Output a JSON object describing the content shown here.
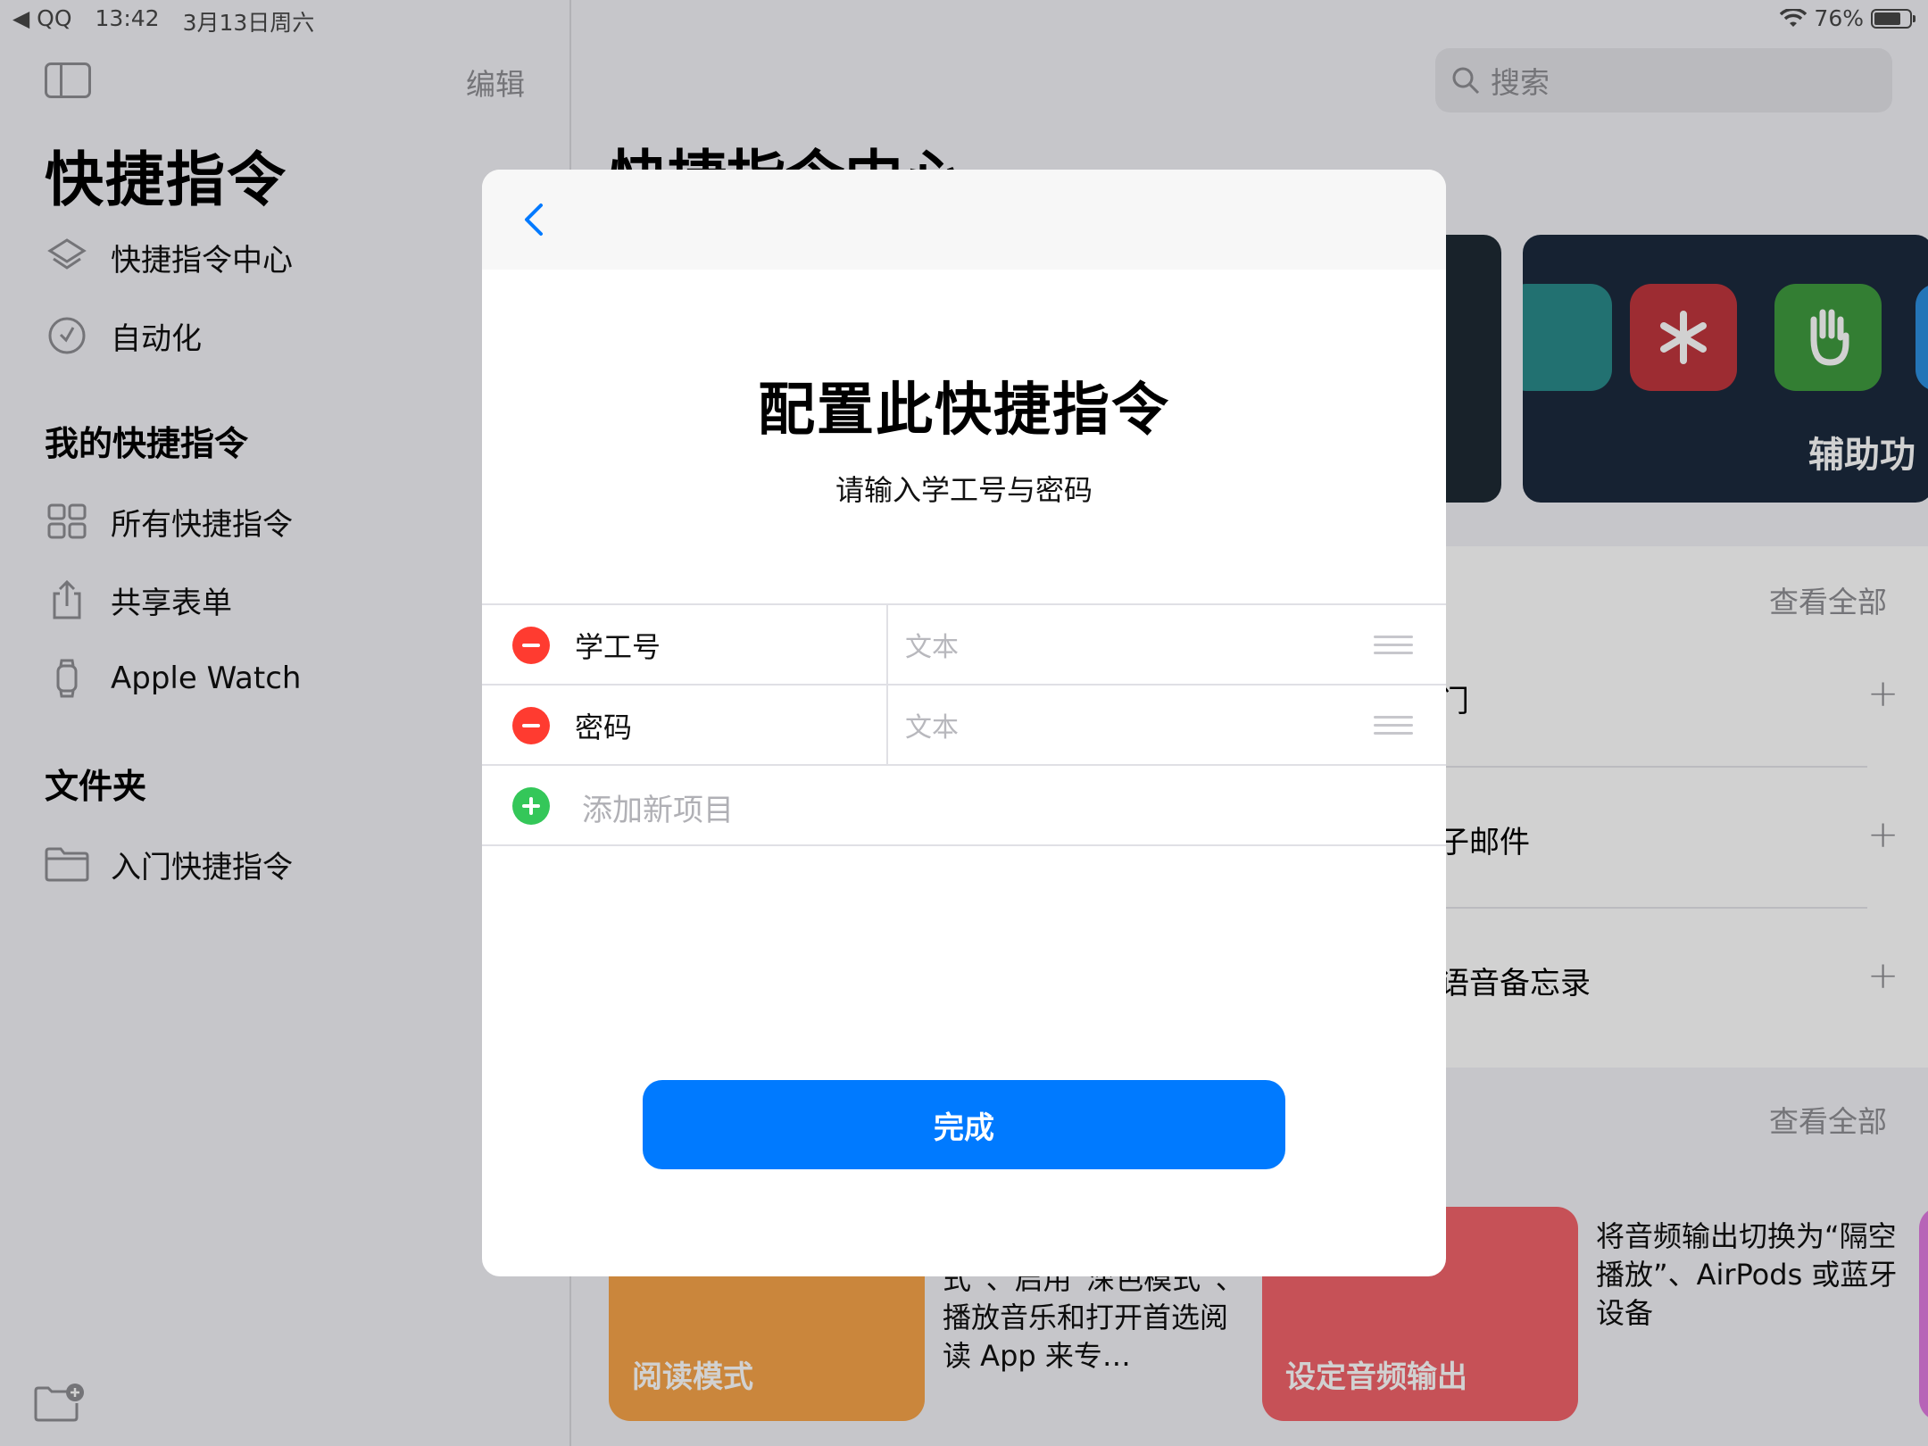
{
  "status_bar": {
    "back_app": "◀ QQ",
    "time": "13:42",
    "date": "3月13日周六",
    "battery": "76%"
  },
  "sidebar": {
    "edit": "编辑",
    "title": "快捷指令",
    "top_items": [
      {
        "label": "快捷指令中心",
        "icon": "layers-icon"
      },
      {
        "label": "自动化",
        "icon": "clock-icon"
      }
    ],
    "my_section": "我的快捷指令",
    "my_items": [
      {
        "label": "所有快捷指令",
        "icon": "grid-icon"
      },
      {
        "label": "共享表单",
        "icon": "share-icon"
      },
      {
        "label": "Apple Watch",
        "icon": "watch-icon"
      }
    ],
    "folders_section": "文件夹",
    "folder_items": [
      {
        "label": "入门快捷指令",
        "icon": "folder-icon"
      }
    ]
  },
  "main": {
    "search_placeholder": "搜索",
    "title": "快捷指令中心",
    "featured_label": "辅助功",
    "see_all_1": "查看全部",
    "see_all_2": "查看全部",
    "rows": [
      {
        "label": "门"
      },
      {
        "label": "子邮件"
      },
      {
        "label": "语音备忘录"
      }
    ],
    "cards": [
      {
        "title": "阅读模式",
        "desc": "式”、启用“深色模式”、播放音乐和打开首选阅读 App 来专…"
      },
      {
        "title": "设定音频输出",
        "desc": "将音频输出切换为“隔空播放”、AirPods 或蓝牙设备"
      }
    ]
  },
  "modal": {
    "title": "配置此快捷指令",
    "subtitle": "请输入学工号与密码",
    "fields": [
      {
        "label": "学工号",
        "placeholder": "文本"
      },
      {
        "label": "密码",
        "placeholder": "文本"
      }
    ],
    "add_item": "添加新项目",
    "done_button": "完成"
  },
  "colors": {
    "accent": "#007aff",
    "delete": "#ff3b30",
    "add": "#34c759"
  }
}
